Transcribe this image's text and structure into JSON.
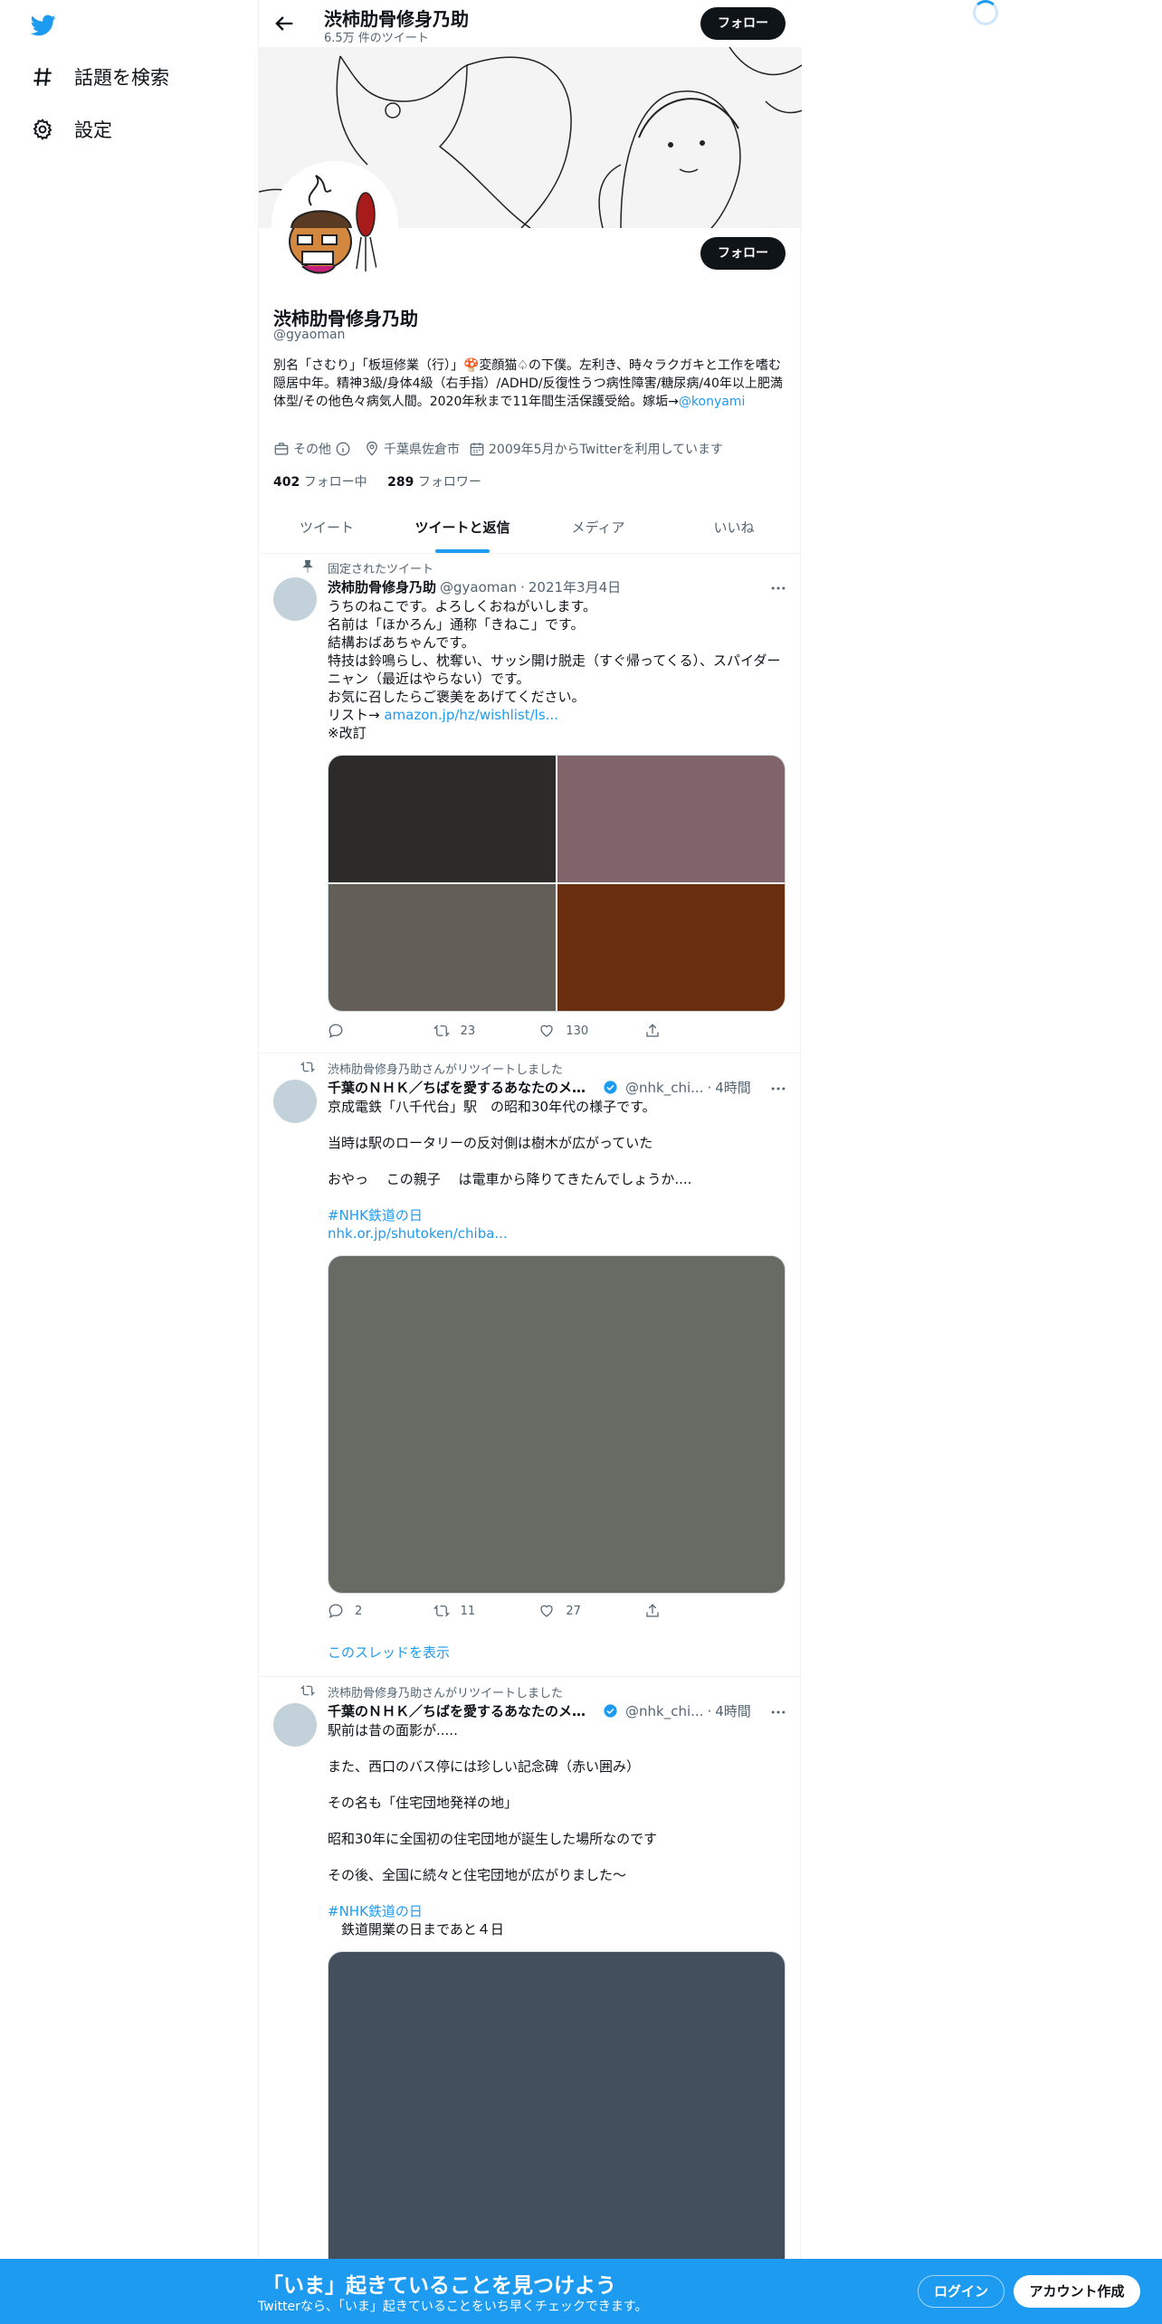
{
  "sidebar": {
    "logo": "twitter-bird-icon",
    "items": [
      {
        "label": "話題を検索",
        "icon": "hashtag-icon"
      },
      {
        "label": "設定",
        "icon": "gear-icon"
      }
    ]
  },
  "header": {
    "name": "渋柿肋骨修身乃助",
    "tweet_count": "6.5万 件のツイート",
    "follow_label": "フォロー"
  },
  "profile": {
    "name": "渋柿肋骨修身乃助",
    "handle": "@gyaoman",
    "follow_label": "フォロー",
    "bio": "別名「さむり」「板垣修業（行）」🍄変顔猫♤の下僕。左利き、時々ラクガキと工作を嗜む隠居中年。精神3級/身体4級（右手指）/ADHD/反復性うつ病性障害/糖尿病/40年以上肥満体型/その他色々病気人間。2020年秋まで11年間生活保護受給。嫁垢→",
    "bio_link": "@konyami",
    "meta": {
      "category": "その他",
      "location": "千葉県佐倉市",
      "joined": "2009年5月からTwitterを利用しています"
    },
    "following_count": "402",
    "following_label": "フォロー中",
    "followers_count": "289",
    "followers_label": "フォロワー"
  },
  "tabs": [
    "ツイート",
    "ツイートと返信",
    "メディア",
    "いいね"
  ],
  "active_tab": 1,
  "tweets": [
    {
      "context": "固定されたツイート",
      "name": "渋柿肋骨修身乃助",
      "handle": "@gyaoman",
      "time": "2021年3月4日",
      "body_lines": [
        "うちのねこです。よろしくおねがいします。",
        "名前は「ほかろん」通称「きねこ」です。",
        "結構おばあちゃんです。",
        "特技は鈴鳴らし、枕奪い、サッシ開け脱走（すぐ帰ってくる）、スパイダーニャン（最近はやらない）です。",
        "お気に召したらご褒美をあげてください。"
      ],
      "list_prefix": "リスト→ ",
      "list_link": "amazon.jp/hz/wishlist/ls...",
      "revision": "※改訂",
      "media_colors": [
        "#2c2b29",
        "#7f646a",
        "#635e58",
        "#682e0e"
      ],
      "reply": "",
      "retweet": "23",
      "like": "130"
    },
    {
      "context": "渋柿肋骨修身乃助さんがリツイートしました",
      "name": "千葉のＮＨＫ／ちばを愛するあなたのメデ...",
      "handle": "@nhk_chi...",
      "time": "4時間",
      "body": "京成電鉄「八千代台」駅　の昭和30年代の様子です。\n\n当時は駅のロータリーの反対側は樹木が広がっていた\n\nおやっ　 この親子　 は電車から降りてきたんでしょうか....",
      "hashtag": "#NHK鉄道の日",
      "link": "nhk.or.jp/shutoken/chiba...",
      "media_color": "#686b64",
      "reply": "2",
      "retweet": "11",
      "like": "27",
      "show_thread": "このスレッドを表示"
    },
    {
      "context": "渋柿肋骨修身乃助さんがリツイートしました",
      "name": "千葉のＮＨＫ／ちばを愛するあなたのメデ...",
      "handle": "@nhk_chi...",
      "time": "4時間",
      "body": "駅前は昔の面影が.....\n\nまた、西口のバス停には珍しい記念碑（赤い囲み）\n\nその名も「住宅団地発祥の地」\n\n昭和30年に全国初の住宅団地が誕生した場所なのです\n\nその後、全国に続々と住宅団地が広がりました～",
      "hashtag": "#NHK鉄道の日",
      "extra": "　鉄道開業の日まであと４日",
      "media_color": "#434f5c"
    }
  ],
  "bottom": {
    "title": "「いま」起きていることを見つけよう",
    "subtitle": "Twitterなら、「いま」起きていることをいち早くチェックできます。",
    "login": "ログイン",
    "signup": "アカウント作成"
  }
}
